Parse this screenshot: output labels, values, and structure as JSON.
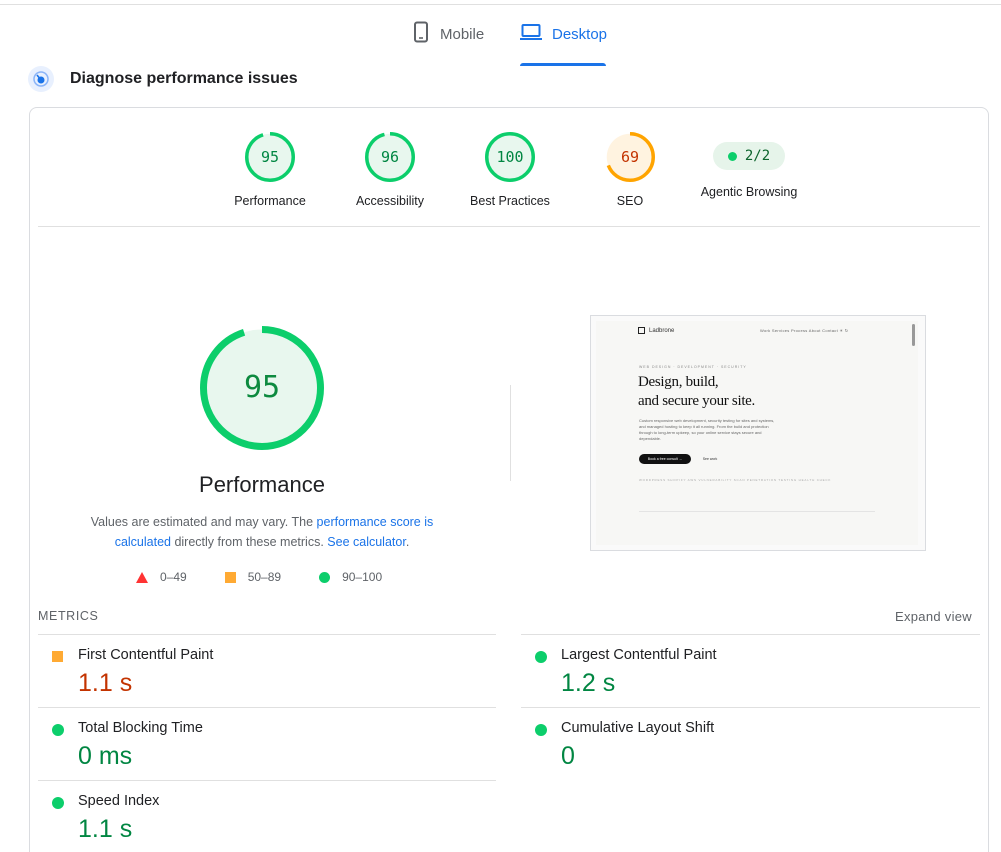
{
  "tabs": {
    "mobile_label": "Mobile",
    "desktop_label": "Desktop",
    "active": "Desktop"
  },
  "diagnose": {
    "title": "Diagnose performance issues"
  },
  "scores": [
    {
      "label": "Performance",
      "value": "95",
      "status": "pass",
      "fraction": 0.95
    },
    {
      "label": "Accessibility",
      "value": "96",
      "status": "pass",
      "fraction": 0.96
    },
    {
      "label": "Best Practices",
      "value": "100",
      "status": "pass",
      "fraction": 1.0
    },
    {
      "label": "SEO",
      "value": "69",
      "status": "average",
      "fraction": 0.69
    }
  ],
  "agentic": {
    "label": "Agentic Browsing",
    "value": "2/2"
  },
  "performance": {
    "score": "95",
    "fraction": 0.95,
    "label": "Performance",
    "disclaimer_1": "Values are estimated and may vary. The ",
    "disclaimer_link_1": "performance score is calculated",
    "disclaimer_2": " directly from these metrics. ",
    "disclaimer_link_2": "See calculator",
    "disclaimer_3": "."
  },
  "legend": {
    "fail": "0–49",
    "average": "50–89",
    "pass": "90–100"
  },
  "screenshot": {
    "brand": "Ladbrone",
    "nav": "Work    Services    Process    About    Contact    ☀    ↻",
    "kicker": "WEB DESIGN · DEVELOPMENT · SECURITY",
    "headline_1": "Design, build,",
    "headline_2": "and secure your site.",
    "body": "Custom responsive web development, security testing for sites and systems, and managed hosting to keep it all running. From the build and protection through to long-term upkeep, so your online service stays secure and dependable.",
    "cta_primary": "Book a free consult →",
    "cta_secondary": "See work",
    "logos": "WORDPRESS    SHOPIFY    AWS    VULNERABILITY SCAN    PENETRATION TESTING    HEALTH CHECK"
  },
  "metrics": {
    "title": "METRICS",
    "expand_label": "Expand view",
    "items": [
      {
        "name": "First Contentful Paint",
        "value": "1.1 s",
        "status": "average"
      },
      {
        "name": "Largest Contentful Paint",
        "value": "1.2 s",
        "status": "pass"
      },
      {
        "name": "Total Blocking Time",
        "value": "0 ms",
        "status": "pass"
      },
      {
        "name": "Cumulative Layout Shift",
        "value": "0",
        "status": "pass"
      },
      {
        "name": "Speed Index",
        "value": "1.1 s",
        "status": "pass"
      }
    ]
  },
  "colors": {
    "pass": "#0cce6b",
    "pass_text": "#018642",
    "average": "#ffa400",
    "average_text": "#c33300",
    "fail": "#ff3333",
    "accent": "#1a73e8"
  },
  "icons": {
    "mobile_tab": "phone-icon",
    "desktop_tab": "laptop-icon",
    "diagnose": "performance-gauge-icon"
  }
}
